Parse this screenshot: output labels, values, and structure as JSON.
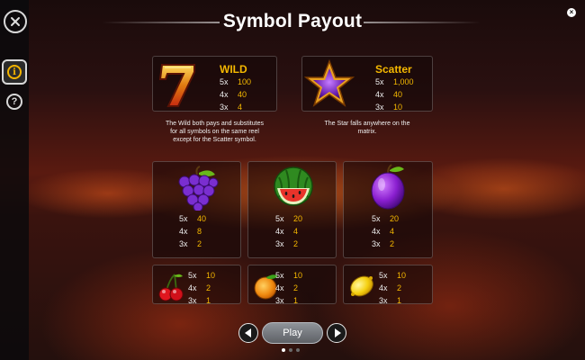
{
  "title": "Symbol Payout",
  "top_symbols": [
    {
      "name": "WILD",
      "icon": "seven-icon",
      "payouts": [
        {
          "mult": "5x",
          "value": "100"
        },
        {
          "mult": "4x",
          "value": "40"
        },
        {
          "mult": "3x",
          "value": "4"
        }
      ],
      "description": [
        "The Wild both pays and substitutes",
        "for all symbols on the same reel",
        "except for the Scatter symbol."
      ]
    },
    {
      "name": "Scatter",
      "icon": "star-icon",
      "payouts": [
        {
          "mult": "5x",
          "value": "1,000"
        },
        {
          "mult": "4x",
          "value": "40"
        },
        {
          "mult": "3x",
          "value": "10"
        }
      ],
      "description": [
        "The Star falls anywhere on the",
        "matrix."
      ]
    }
  ],
  "mid_symbols": [
    {
      "icon": "grapes-icon",
      "payouts": [
        {
          "mult": "5x",
          "value": "40"
        },
        {
          "mult": "4x",
          "value": "8"
        },
        {
          "mult": "3x",
          "value": "2"
        }
      ]
    },
    {
      "icon": "watermelon-icon",
      "payouts": [
        {
          "mult": "5x",
          "value": "20"
        },
        {
          "mult": "4x",
          "value": "4"
        },
        {
          "mult": "3x",
          "value": "2"
        }
      ]
    },
    {
      "icon": "plum-icon",
      "payouts": [
        {
          "mult": "5x",
          "value": "20"
        },
        {
          "mult": "4x",
          "value": "4"
        },
        {
          "mult": "3x",
          "value": "2"
        }
      ]
    }
  ],
  "low_symbols": [
    {
      "icon": "cherries-icon",
      "payouts": [
        {
          "mult": "5x",
          "value": "10"
        },
        {
          "mult": "4x",
          "value": "2"
        },
        {
          "mult": "3x",
          "value": "1"
        }
      ]
    },
    {
      "icon": "orange-icon",
      "payouts": [
        {
          "mult": "5x",
          "value": "10"
        },
        {
          "mult": "4x",
          "value": "2"
        },
        {
          "mult": "3x",
          "value": "1"
        }
      ]
    },
    {
      "icon": "lemon-icon",
      "payouts": [
        {
          "mult": "5x",
          "value": "10"
        },
        {
          "mult": "4x",
          "value": "2"
        },
        {
          "mult": "3x",
          "value": "1"
        }
      ]
    }
  ],
  "sidebar": {
    "close_icon": "close-icon",
    "info_icon": "info-icon",
    "info_glyph": "i",
    "help_icon": "help-icon",
    "help_glyph": "?"
  },
  "corner_close_glyph": "×",
  "nav": {
    "play_label": "Play",
    "page_count": 3,
    "current_page": 1
  },
  "colors": {
    "accent": "#f5b800",
    "panel_border": "#6b5a5a"
  }
}
